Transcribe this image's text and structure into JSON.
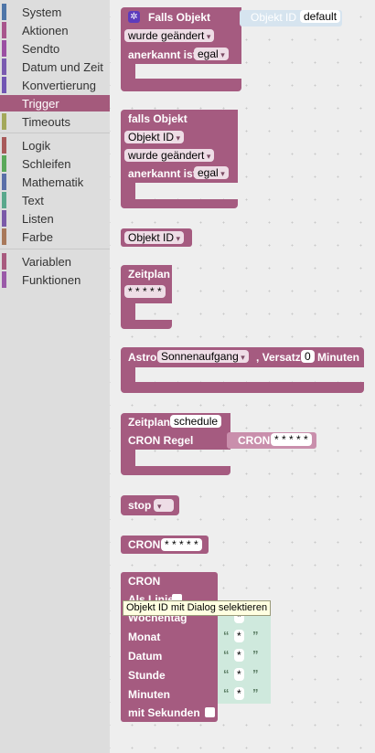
{
  "toolbox": {
    "categories": [
      {
        "label": "System",
        "color": "#4e75a8"
      },
      {
        "label": "Aktionen",
        "color": "#a8558c"
      },
      {
        "label": "Sendto",
        "color": "#9b4fa3"
      },
      {
        "label": "Datum und Zeit",
        "color": "#7a5bb0"
      },
      {
        "label": "Konvertierung",
        "color": "#7156b3"
      },
      {
        "label": "Trigger",
        "color": "#a45a7c"
      },
      {
        "label": "Timeouts",
        "color": "#a3a85a"
      },
      {
        "label": "Logik",
        "color": "#a85a5a"
      },
      {
        "label": "Schleifen",
        "color": "#5aa85a"
      },
      {
        "label": "Mathematik",
        "color": "#5a6fa8"
      },
      {
        "label": "Text",
        "color": "#5aa88c"
      },
      {
        "label": "Listen",
        "color": "#7a5aa8"
      },
      {
        "label": "Farbe",
        "color": "#a8785a"
      },
      {
        "label": "Variablen",
        "color": "#a85a7e"
      },
      {
        "label": "Funktionen",
        "color": "#9a5aa8"
      }
    ],
    "selected": "Trigger"
  },
  "blocks": {
    "falls_objekt": {
      "title": "Falls Objekt",
      "input_label": "Objekt ID",
      "input_value": "default",
      "changed": "wurde geändert",
      "ack_label": "anerkannt ist",
      "ack_value": "egal"
    },
    "falls_objekt2": {
      "title": "falls Objekt",
      "object_id": "Objekt ID",
      "changed": "wurde geändert",
      "ack_label": "anerkannt ist",
      "ack_value": "egal"
    },
    "objekt_id": {
      "value": "Objekt ID"
    },
    "zeitplan": {
      "title": "Zeitplan",
      "value": "* * * * *"
    },
    "astro": {
      "title": "Astro",
      "event": "Sonnenaufgang",
      "offset_label": ", Versatz",
      "offset_value": "0",
      "unit": "Minuten"
    },
    "zeitplan_cron": {
      "title": "Zeitplan",
      "name": "schedule",
      "rule_label": "CRON Regel",
      "cron_label": "CRON",
      "cron_value": "* * * * *"
    },
    "stop": {
      "title": "stop"
    },
    "cron_value": {
      "title": "CRON",
      "value": "* * * * *"
    },
    "cron_builder": {
      "title": "CRON",
      "as_line": "Als Linie",
      "tooltip": "Objekt ID mit Dialog selektieren",
      "rows": [
        {
          "label": "Wochentag",
          "value": "*"
        },
        {
          "label": "Monat",
          "value": "*"
        },
        {
          "label": "Datum",
          "value": "*"
        },
        {
          "label": "Stunde",
          "value": "*"
        },
        {
          "label": "Minuten",
          "value": "*"
        }
      ],
      "seconds_label": "mit Sekunden"
    }
  }
}
